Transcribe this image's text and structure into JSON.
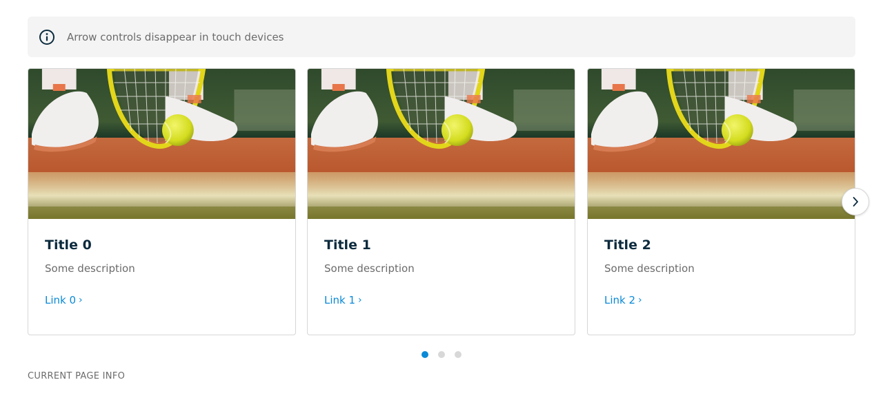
{
  "notice": {
    "text": "Arrow controls disappear in touch devices",
    "icon": "info-icon"
  },
  "cards": [
    {
      "title": "Title 0",
      "description": "Some description",
      "link": "Link 0"
    },
    {
      "title": "Title 1",
      "description": "Some description",
      "link": "Link 1"
    },
    {
      "title": "Title 2",
      "description": "Some description",
      "link": "Link 2"
    }
  ],
  "carousel": {
    "next_icon": "chevron-right-icon",
    "pagination": {
      "count": 3,
      "active_index": 0
    }
  },
  "colors": {
    "accent": "#0a8ad6",
    "title": "#0b2a3d",
    "muted": "#6b6b6b",
    "notice_bg": "#f4f4f4"
  },
  "page_info": "CURRENT PAGE INFO"
}
